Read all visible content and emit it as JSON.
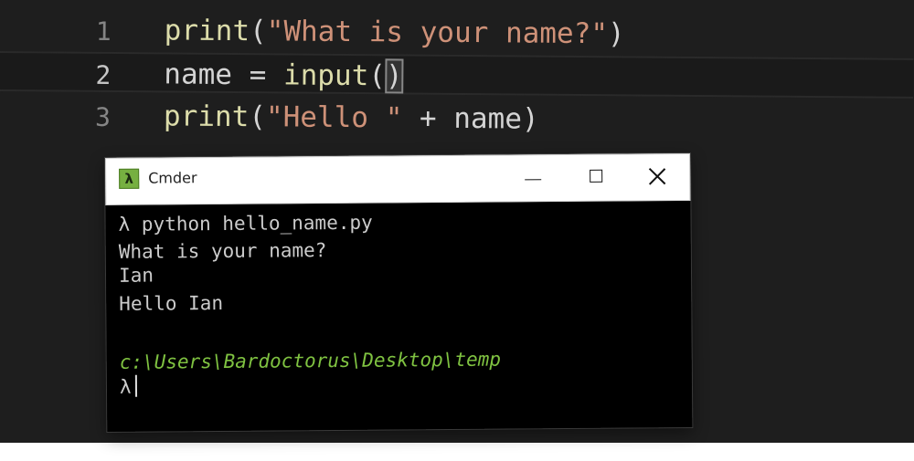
{
  "editor": {
    "lines": [
      {
        "num": "1",
        "t1": "print",
        "t2": "(",
        "t3": "\"What is your name?\"",
        "t4": ")"
      },
      {
        "num": "2",
        "t1": "name",
        "t2": " = ",
        "t3": "input",
        "t4": "(",
        "t5": ")"
      },
      {
        "num": "3",
        "t1": "print",
        "t2": "(",
        "t3": "\"Hello \"",
        "t4": " + name)"
      }
    ]
  },
  "terminal": {
    "title": "Cmder",
    "icon_glyph": "λ",
    "lines": [
      "λ python hello_name.py",
      "What is your name?",
      "Ian",
      "Hello Ian"
    ],
    "path": "c:\\Users\\Bardoctorus\\Desktop\\temp",
    "prompt": "λ"
  },
  "colors": {
    "editor_bg": "#1e1e1e",
    "function": "#dcdcaa",
    "string": "#ce9178",
    "console_bg": "#000000",
    "path_green": "#7fc241"
  }
}
